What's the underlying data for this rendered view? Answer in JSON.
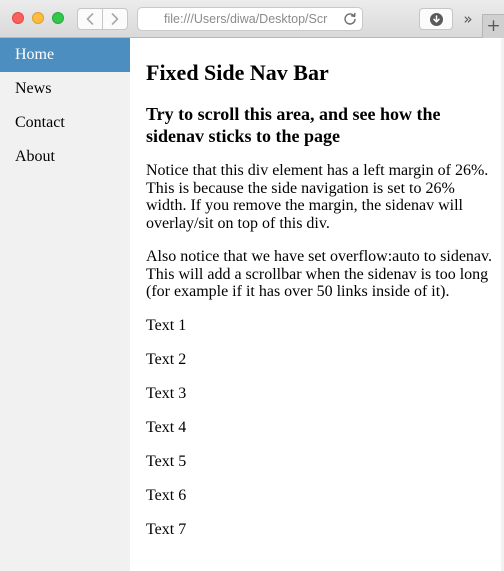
{
  "browser": {
    "address_text": "file:///Users/diwa/Desktop/Scr",
    "overflow_glyph": "»",
    "newtab_glyph": "+"
  },
  "sidenav": {
    "items": [
      {
        "label": "Home",
        "active": true
      },
      {
        "label": "News",
        "active": false
      },
      {
        "label": "Contact",
        "active": false
      },
      {
        "label": "About",
        "active": false
      }
    ],
    "active_color": "#4c8ebf",
    "background": "#f1f1f1"
  },
  "main": {
    "title": "Fixed Side Nav Bar",
    "subtitle": "Try to scroll this area, and see how the sidenav sticks to the page",
    "paragraph1": "Notice that this div element has a left margin of 26%. This is because the side navigation is set to 26% width. If you remove the margin, the sidenav will overlay/sit on top of this div.",
    "paragraph2": "Also notice that we have set overflow:auto to sidenav. This will add a scrollbar when the sidenav is too long (for example if it has over 50 links inside of it).",
    "texts": [
      "Text 1",
      "Text 2",
      "Text 3",
      "Text 4",
      "Text 5",
      "Text 6",
      "Text 7"
    ]
  }
}
